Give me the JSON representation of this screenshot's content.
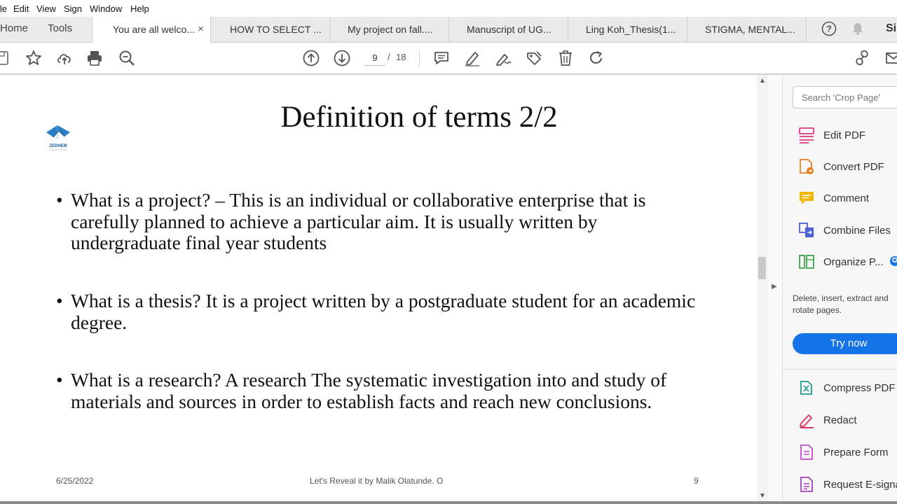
{
  "menu": [
    "ile",
    "Edit",
    "View",
    "Sign",
    "Window",
    "Help"
  ],
  "nav": {
    "home": "Home",
    "tools": "Tools"
  },
  "tabs": [
    {
      "label": "You are all welco..."
    },
    {
      "label": "HOW TO SELECT ..."
    },
    {
      "label": "My project on fall...."
    },
    {
      "label": "Manuscript of UG..."
    },
    {
      "label": "Ling Koh_Thesis(1..."
    },
    {
      "label": "STIGMA, MENTAL..."
    }
  ],
  "tab_close": "×",
  "header_right_text": "Si",
  "toolbar": {
    "page_current": "9",
    "page_sep": "/",
    "page_total": "18"
  },
  "slide": {
    "title": "Definition of terms 2/2",
    "logo_text": "ZEDHEM",
    "bullets": [
      "What is a project? – This is an individual or collaborative enterprise that is carefully planned to achieve a particular aim. It is usually written by undergraduate  final year students",
      "What is a thesis? It is a  project written by a postgraduate student for an academic degree.",
      "What is a research?  A research The systematic investigation into and study of materials and sources in order to establish facts and reach new conclusions."
    ],
    "bullet_mark": "•",
    "footer_date": "6/25/2022",
    "footer_center": "Let's Reveal it by Malik Olatunde. O",
    "footer_page": "9"
  },
  "right_panel": {
    "search_placeholder": "Search 'Crop Page'",
    "tools": [
      {
        "label": "Edit PDF",
        "icon": "edit-pdf-icon",
        "color": "#e0397a"
      },
      {
        "label": "Convert PDF",
        "icon": "convert-pdf-icon",
        "color": "#e8801f"
      },
      {
        "label": "Comment",
        "icon": "comment-icon",
        "color": "#f2b705"
      },
      {
        "label": "Combine Files",
        "icon": "combine-files-icon",
        "color": "#4a5fd6"
      },
      {
        "label": "Organize P...",
        "icon": "organize-pages-icon",
        "color": "#3fa34d"
      }
    ],
    "description": "Delete, insert, extract and rotate pages.",
    "try_now": "Try now",
    "tools2": [
      {
        "label": "Compress PDF",
        "icon": "compress-pdf-icon",
        "color": "#1f9a8a"
      },
      {
        "label": "Redact",
        "icon": "redact-icon",
        "color": "#d8345f"
      },
      {
        "label": "Prepare Form",
        "icon": "prepare-form-icon",
        "color": "#c44ac9"
      },
      {
        "label": "Request E-signa",
        "icon": "request-esign-icon",
        "color": "#a63fbf"
      }
    ]
  },
  "colors": {
    "accent": "#1473e6",
    "badge_star": "#1473e6"
  }
}
